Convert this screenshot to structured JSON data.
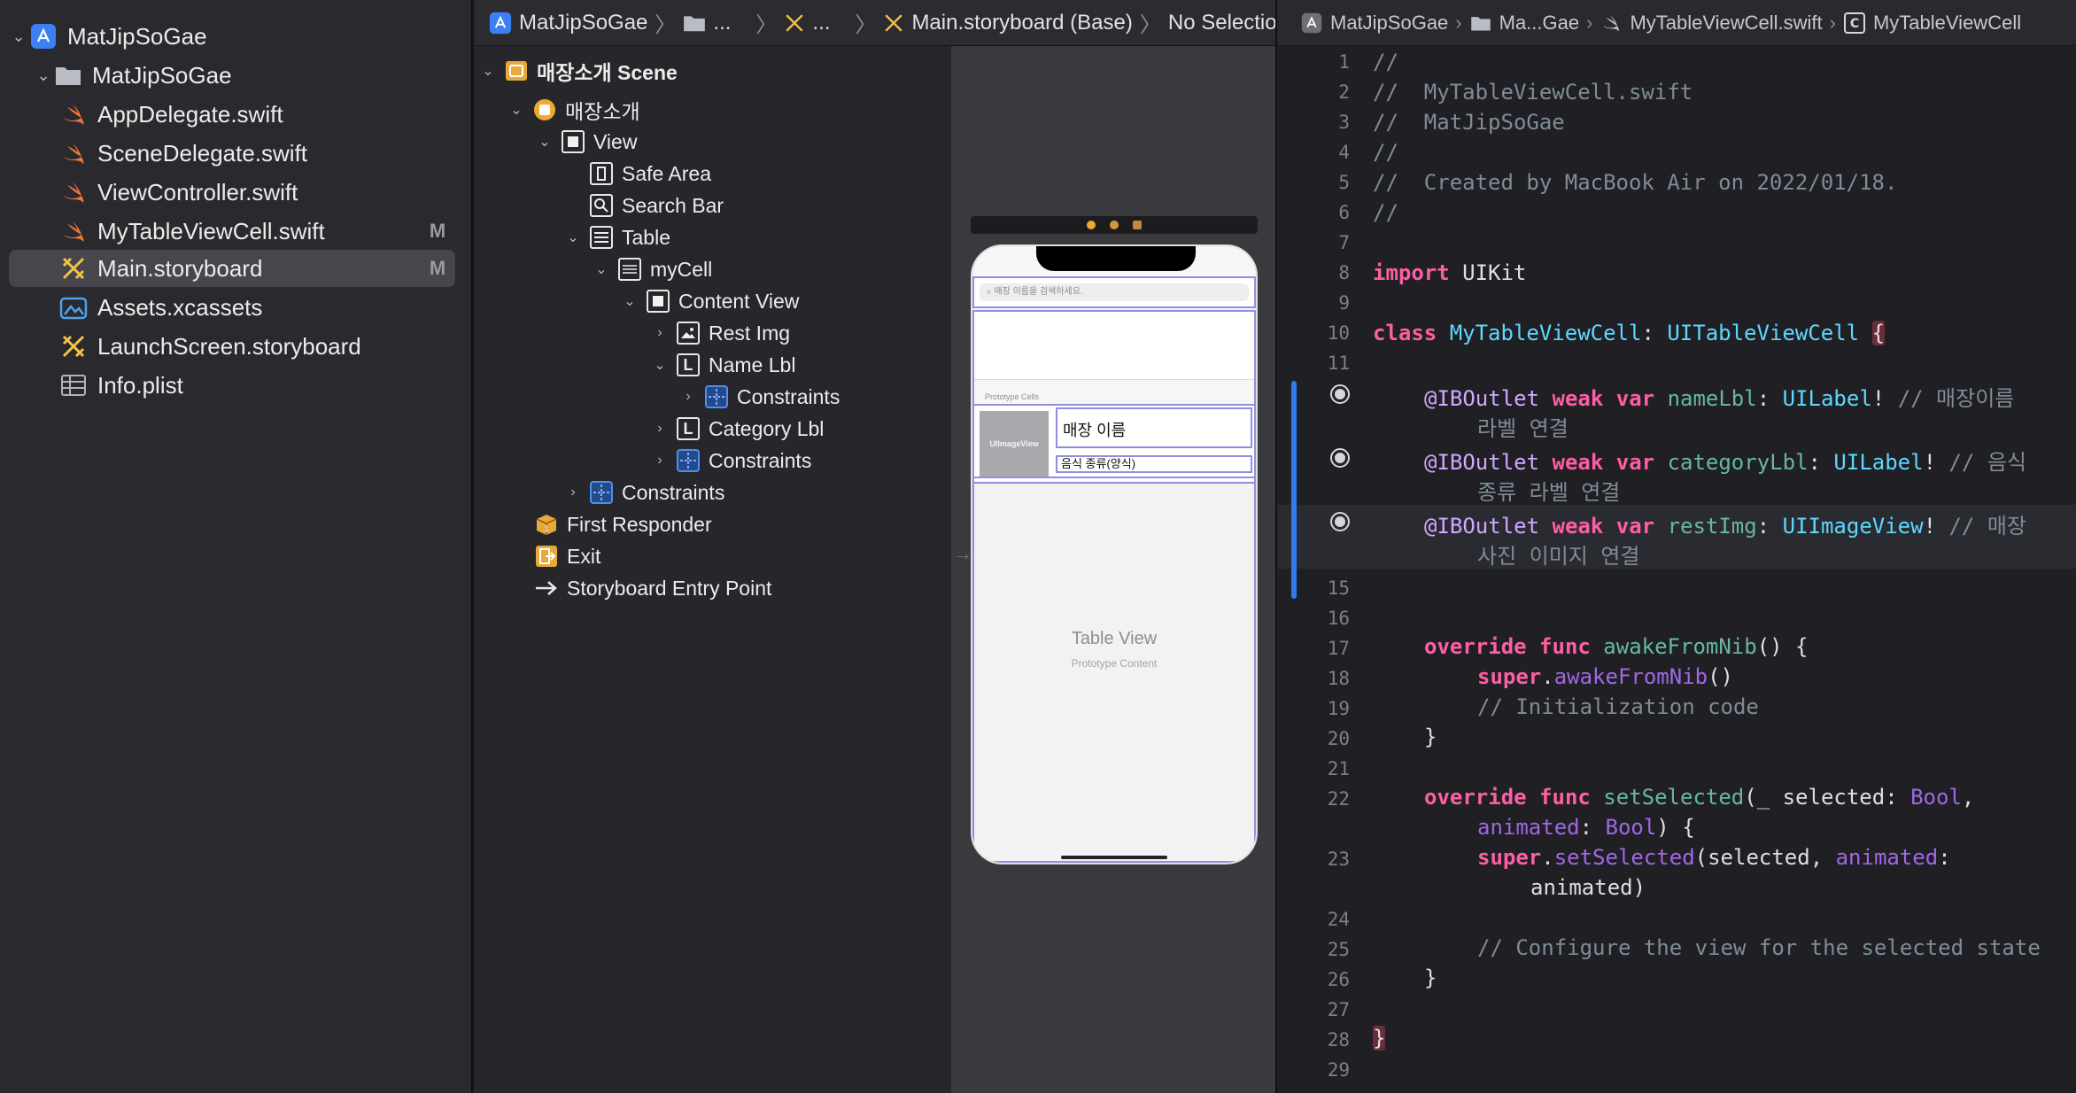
{
  "navigator": {
    "items": [
      {
        "label": "MatJipSoGae",
        "icon": "app-project-icon",
        "badge": ""
      },
      {
        "label": "MatJipSoGae",
        "icon": "folder-icon",
        "badge": ""
      },
      {
        "label": "AppDelegate.swift",
        "icon": "swift-file-icon",
        "badge": ""
      },
      {
        "label": "SceneDelegate.swift",
        "icon": "swift-file-icon",
        "badge": ""
      },
      {
        "label": "ViewController.swift",
        "icon": "swift-file-icon",
        "badge": ""
      },
      {
        "label": "MyTableViewCell.swift",
        "icon": "swift-file-icon",
        "badge": "M"
      },
      {
        "label": "Main.storyboard",
        "icon": "storyboard-icon",
        "badge": "M"
      },
      {
        "label": "Assets.xcassets",
        "icon": "assets-icon",
        "badge": ""
      },
      {
        "label": "LaunchScreen.storyboard",
        "icon": "storyboard-icon",
        "badge": ""
      },
      {
        "label": "Info.plist",
        "icon": "plist-icon",
        "badge": ""
      }
    ]
  },
  "jump_bar": {
    "project": "MatJipSoGae",
    "folder": "...",
    "file": "...",
    "storyboard": "Main.storyboard (Base)",
    "selection": "No Selection"
  },
  "outline": {
    "items": [
      {
        "label": "매장소개 Scene",
        "icon": "scene-icon"
      },
      {
        "label": "매장소개",
        "icon": "view-controller-icon"
      },
      {
        "label": "View",
        "icon": "view-icon"
      },
      {
        "label": "Safe Area",
        "icon": "safe-area-icon"
      },
      {
        "label": "Search Bar",
        "icon": "search-bar-icon"
      },
      {
        "label": "Table",
        "icon": "table-icon"
      },
      {
        "label": "myCell",
        "icon": "table-cell-icon"
      },
      {
        "label": "Content View",
        "icon": "view-icon"
      },
      {
        "label": "Rest Img",
        "icon": "image-view-icon"
      },
      {
        "label": "Name Lbl",
        "icon": "label-icon"
      },
      {
        "label": "Constraints",
        "icon": "constraints-icon"
      },
      {
        "label": "Category Lbl",
        "icon": "label-icon"
      },
      {
        "label": "Constraints",
        "icon": "constraints-icon"
      },
      {
        "label": "Constraints",
        "icon": "constraints-icon"
      },
      {
        "label": "First Responder",
        "icon": "first-responder-icon"
      },
      {
        "label": "Exit",
        "icon": "exit-icon"
      },
      {
        "label": "Storyboard Entry Point",
        "icon": "entry-point-arrow-icon"
      }
    ]
  },
  "canvas": {
    "search_placeholder": "매장 이름을 검색하세요.",
    "prototype_cells_header": "Prototype Cells",
    "cell_image_label": "UIImageView",
    "cell_name": "매장 이름",
    "cell_category": "음식 종류(양식)",
    "table_title": "Table View",
    "table_subtitle": "Prototype Content"
  },
  "editor": {
    "breadcrumb": {
      "project": "MatJipSoGae",
      "folder": "Ma...Gae",
      "file": "MyTableViewCell.swift",
      "class": "MyTableViewCell"
    },
    "line_numbers": [
      "1",
      "2",
      "3",
      "4",
      "5",
      "6",
      "7",
      "8",
      "9",
      "10",
      "11",
      "",
      "",
      "",
      "15",
      "16",
      "17",
      "18",
      "19",
      "20",
      "21",
      "22",
      "23",
      "24",
      "25",
      "26",
      "27",
      "28",
      "29"
    ],
    "code": {
      "l1": "//",
      "l2": "//  MyTableViewCell.swift",
      "l3": "//  MatJipSoGae",
      "l4": "//",
      "l5": "//  Created by MacBook Air on 2022/01/18.",
      "l6": "//",
      "l8_kw": "import",
      "l8_rest": " UIKit",
      "l10_kw": "class",
      "l10_name": "MyTableViewCell",
      "l10_type": "UITableViewCell",
      "outlet_attr": "@IBOutlet",
      "outlet_weak": "weak",
      "outlet_var": "var",
      "o1_name": "nameLbl",
      "o1_type": "UILabel",
      "o1_comment": "// 매장이름",
      "o1_comment2": "라벨 연결",
      "o2_name": "categoryLbl",
      "o2_type": "UILabel",
      "o2_comment": "// 음식",
      "o2_comment2": "종류 라벨 연결",
      "o3_name": "restImg",
      "o3_type": "UIImageView",
      "o3_comment": "// 매장",
      "o3_comment2": "사진 이미지 연결",
      "override": "override",
      "func": "func",
      "awake": "awakeFromNib",
      "super": "super",
      "init_comment": "// Initialization code",
      "setSelected": "setSelected",
      "selected_param": "_ selected",
      "bool": "Bool",
      "animated": "animated",
      "configure_comment": "// Configure the view for the selected state"
    }
  }
}
